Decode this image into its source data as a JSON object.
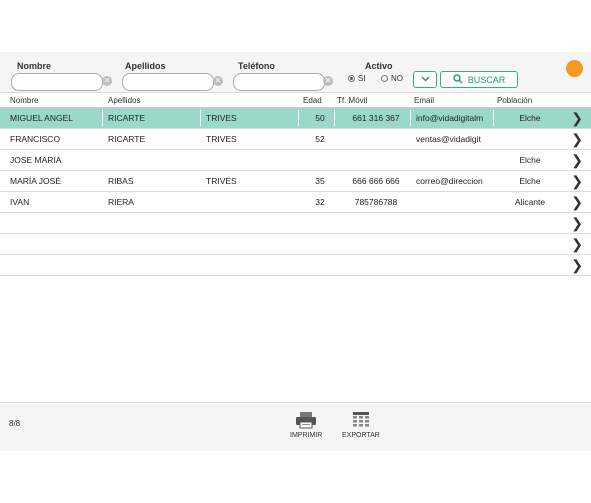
{
  "filters": {
    "nombre_label": "Nombre",
    "apellidos_label": "Apellidos",
    "telefono_label": "Teléfono",
    "activo_label": "Activo",
    "radio_si": "SI",
    "radio_no": "NO",
    "search_label": "BUSCAR",
    "nombre_value": "",
    "apellidos_value": "",
    "telefono_value": ""
  },
  "table": {
    "headers": [
      "Nombre",
      "Apellidos",
      "Edad",
      "Tf. Móvil",
      "Email",
      "Población"
    ],
    "rows": [
      {
        "nombre": "MIGUEL ANGEL",
        "apellido1": "RICARTE",
        "apellido2": "TRIVES",
        "edad": "50",
        "movil": "661 316 367",
        "email": "info@vidadigitalm",
        "poblacion": "Elche"
      },
      {
        "nombre": "FRANCISCO",
        "apellido1": "RICARTE",
        "apellido2": "TRIVES",
        "edad": "52",
        "movil": "",
        "email": "ventas@vidadigit",
        "poblacion": ""
      },
      {
        "nombre": "JOSE MARIA",
        "apellido1": "",
        "apellido2": "",
        "edad": "",
        "movil": "",
        "email": "",
        "poblacion": "Elche"
      },
      {
        "nombre": "MARÍA JOSÉ",
        "apellido1": "RIBAS",
        "apellido2": "TRIVES",
        "edad": "35",
        "movil": "666 666 666",
        "email": "correo@direccion",
        "poblacion": "Elche"
      },
      {
        "nombre": "IVAN",
        "apellido1": "RIERA",
        "apellido2": "",
        "edad": "32",
        "movil": "785786788",
        "email": "",
        "poblacion": "Alicante"
      }
    ]
  },
  "footer": {
    "count": "8/8",
    "print_label": "IMPRIMIR",
    "export_label": "EXPORTAR"
  },
  "colors": {
    "accent": "#1f9a77",
    "selected_row": "#9ad9c9",
    "orange_dot": "#f39a22"
  },
  "icons": [
    "clear-icon",
    "chevron-down-icon",
    "search-icon",
    "chevron-right-icon",
    "printer-icon",
    "export-icon"
  ]
}
